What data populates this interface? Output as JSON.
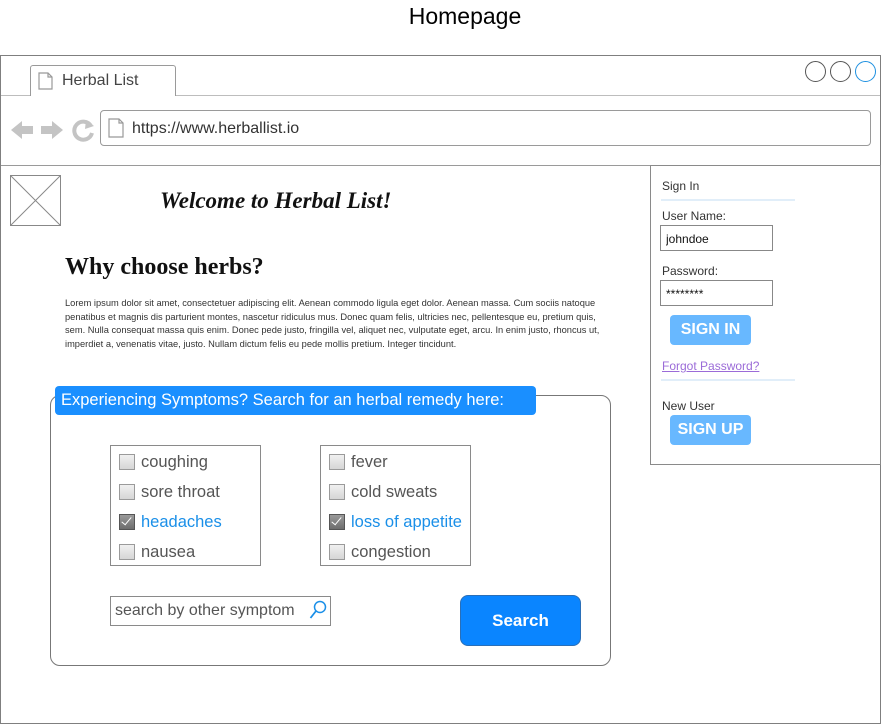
{
  "page_title": "Homepage",
  "browser": {
    "tab_title": "Herbal List",
    "url": "https://www.herballist.io"
  },
  "content": {
    "welcome": "Welcome to Herbal List!",
    "why_heading": "Why choose herbs?",
    "lorem": "Lorem ipsum dolor sit amet, consectetuer adipiscing elit. Aenean commodo ligula eget dolor. Aenean massa. Cum sociis natoque penatibus et magnis dis parturient montes, nascetur ridiculus mus. Donec quam felis, ultricies nec, pellentesque eu, pretium quis, sem. Nulla consequat massa quis enim. Donec pede justo, fringilla vel, aliquet nec, vulputate eget, arcu. In enim justo, rhoncus ut, imperdiet a, venenatis vitae, justo. Nullam dictum felis eu pede mollis pretium. Integer tincidunt."
  },
  "search": {
    "banner": "Experiencing Symptoms? Search for an herbal remedy here:",
    "symptoms_left": [
      {
        "label": "coughing",
        "checked": false
      },
      {
        "label": "sore throat",
        "checked": false
      },
      {
        "label": "headaches",
        "checked": true
      },
      {
        "label": "nausea",
        "checked": false
      }
    ],
    "symptoms_right": [
      {
        "label": "fever",
        "checked": false
      },
      {
        "label": "cold sweats",
        "checked": false
      },
      {
        "label": "loss of appetite",
        "checked": true
      },
      {
        "label": "congestion",
        "checked": false
      }
    ],
    "other_placeholder": "search by other symptom",
    "button_label": "Search"
  },
  "signin": {
    "title": "Sign In",
    "username_label": "User Name:",
    "username_value": "johndoe",
    "password_label": "Password:",
    "password_value": "********",
    "signin_button": "SIGN IN",
    "forgot_link": "Forgot Password?",
    "new_user_label": "New User",
    "signup_button": "SIGN UP"
  },
  "colors": {
    "accent": "#1a8fff",
    "checked_text": "#1a8fe8",
    "light_button": "#68b8ff",
    "link": "#9b6bd8"
  }
}
